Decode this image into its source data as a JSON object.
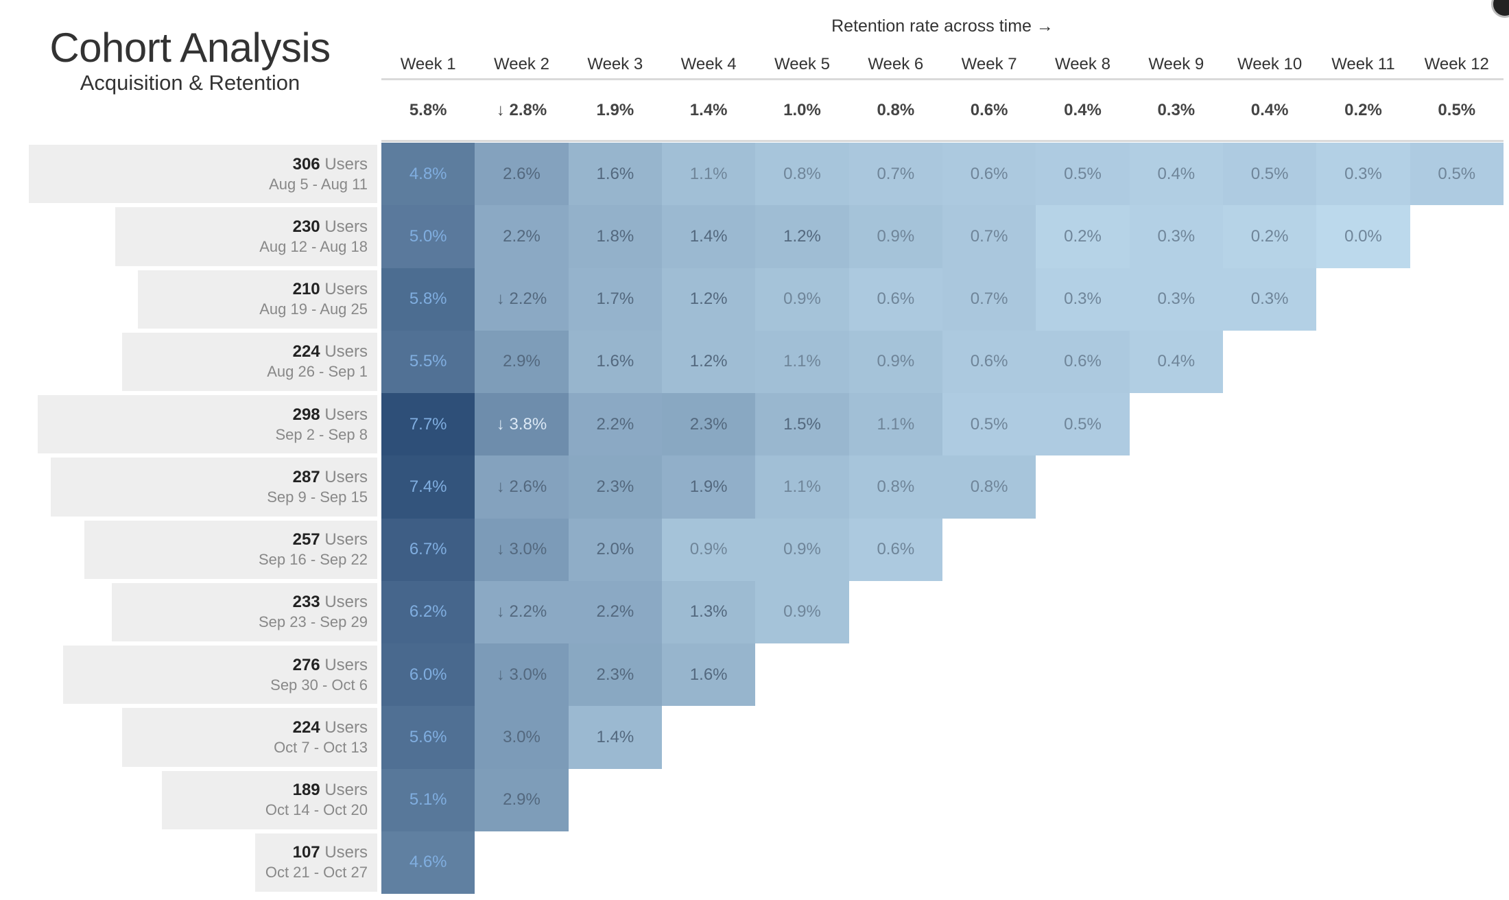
{
  "header": {
    "title": "Cohort Analysis",
    "subtitle": "Acquisition & Retention",
    "axis_caption": "Retention rate across time →"
  },
  "corner_icon": "settings-circle-icon",
  "chart_data": {
    "type": "heatmap",
    "title": "Cohort Analysis",
    "subtitle": "Acquisition & Retention",
    "xlabel": "Retention rate across time",
    "weeks": [
      "Week 1",
      "Week 2",
      "Week 3",
      "Week 4",
      "Week 5",
      "Week 6",
      "Week 7",
      "Week 8",
      "Week 9",
      "Week 10",
      "Week 11",
      "Week 12"
    ],
    "weekly_average": [
      {
        "value": 5.8,
        "decline": false
      },
      {
        "value": 2.8,
        "decline": true
      },
      {
        "value": 1.9,
        "decline": false
      },
      {
        "value": 1.4,
        "decline": false
      },
      {
        "value": 1.0,
        "decline": false
      },
      {
        "value": 0.8,
        "decline": false
      },
      {
        "value": 0.6,
        "decline": false
      },
      {
        "value": 0.4,
        "decline": false
      },
      {
        "value": 0.3,
        "decline": false
      },
      {
        "value": 0.4,
        "decline": false
      },
      {
        "value": 0.2,
        "decline": false
      },
      {
        "value": 0.5,
        "decline": false
      }
    ],
    "users_suffix": "Users",
    "value_unit": "%",
    "decline_marker": "↓",
    "color_scale": {
      "low": "#bcd9ec",
      "high": "#2e4f78",
      "min": 0.0,
      "max": 7.7
    },
    "cohorts": [
      {
        "users": 306,
        "dates": "Aug 5 - Aug 11",
        "values": [
          4.8,
          2.6,
          1.6,
          1.1,
          0.8,
          0.7,
          0.6,
          0.5,
          0.4,
          0.5,
          0.3,
          0.5
        ],
        "declines": []
      },
      {
        "users": 230,
        "dates": "Aug 12 - Aug 18",
        "values": [
          5.0,
          2.2,
          1.8,
          1.4,
          1.2,
          0.9,
          0.7,
          0.2,
          0.3,
          0.2,
          0.0
        ],
        "declines": []
      },
      {
        "users": 210,
        "dates": "Aug 19 - Aug 25",
        "values": [
          5.8,
          2.2,
          1.7,
          1.2,
          0.9,
          0.6,
          0.7,
          0.3,
          0.3,
          0.3
        ],
        "declines": [
          1
        ]
      },
      {
        "users": 224,
        "dates": "Aug 26 - Sep 1",
        "values": [
          5.5,
          2.9,
          1.6,
          1.2,
          1.1,
          0.9,
          0.6,
          0.6,
          0.4
        ],
        "declines": []
      },
      {
        "users": 298,
        "dates": "Sep 2 - Sep 8",
        "values": [
          7.7,
          3.8,
          2.2,
          2.3,
          1.5,
          1.1,
          0.5,
          0.5
        ],
        "declines": [
          1
        ]
      },
      {
        "users": 287,
        "dates": "Sep 9 - Sep 15",
        "values": [
          7.4,
          2.6,
          2.3,
          1.9,
          1.1,
          0.8,
          0.8
        ],
        "declines": [
          1
        ]
      },
      {
        "users": 257,
        "dates": "Sep 16 - Sep 22",
        "values": [
          6.7,
          3.0,
          2.0,
          0.9,
          0.9,
          0.6
        ],
        "declines": [
          1
        ]
      },
      {
        "users": 233,
        "dates": "Sep 23 - Sep 29",
        "values": [
          6.2,
          2.2,
          2.2,
          1.3,
          0.9
        ],
        "declines": [
          1
        ]
      },
      {
        "users": 276,
        "dates": "Sep 30 - Oct 6",
        "values": [
          6.0,
          3.0,
          2.3,
          1.6
        ],
        "declines": [
          1
        ]
      },
      {
        "users": 224,
        "dates": "Oct 7 - Oct 13",
        "values": [
          5.6,
          3.0,
          1.4
        ],
        "declines": []
      },
      {
        "users": 189,
        "dates": "Oct 14 - Oct 20",
        "values": [
          5.1,
          2.9
        ],
        "declines": []
      },
      {
        "users": 107,
        "dates": "Oct 21 - Oct 27",
        "values": [
          4.6
        ],
        "declines": []
      }
    ]
  }
}
